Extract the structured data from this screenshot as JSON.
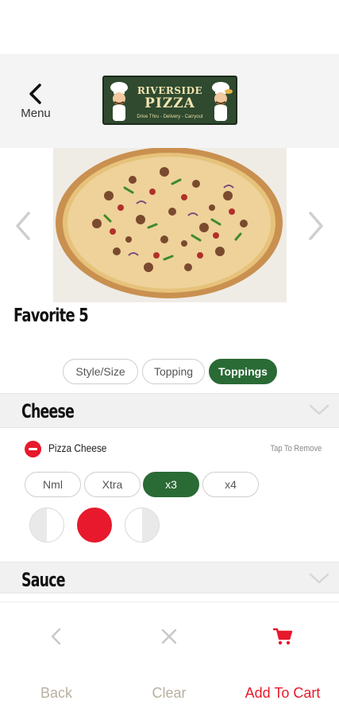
{
  "header": {
    "menu_label": "Menu",
    "logo": {
      "line1": "RIVERSIDE",
      "line2": "PIZZA",
      "line3": "Drive Thru - Delivery - Carryout"
    }
  },
  "item": {
    "title": "Favorite 5"
  },
  "tabs": [
    {
      "label": "Style/Size",
      "active": false
    },
    {
      "label": "Topping",
      "active": false
    },
    {
      "label": "Toppings",
      "active": true
    }
  ],
  "sections": {
    "cheese": {
      "title": "Cheese"
    },
    "sauce": {
      "title": "Sauce"
    }
  },
  "topping": {
    "name": "Pizza Cheese",
    "remove_hint": "Tap To Remove",
    "quantity_options": [
      "Nml",
      "Xtra",
      "x3",
      "x4"
    ],
    "selected_quantity": "x3",
    "portions": [
      "left-half",
      "whole",
      "right-half"
    ],
    "selected_portion": "whole"
  },
  "bottom_bar": {
    "back_label": "Back",
    "clear_label": "Clear",
    "cart_label": "Add To Cart"
  },
  "colors": {
    "accent_green": "#2a6a35",
    "accent_red": "#e8192c"
  }
}
